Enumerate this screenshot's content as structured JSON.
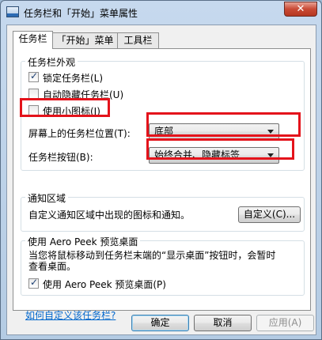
{
  "window": {
    "title": "任务栏和「开始」菜单属性",
    "close_glyph": "✕"
  },
  "tabs": [
    {
      "label": "任务栏",
      "active": true
    },
    {
      "label": "「开始」菜单",
      "active": false
    },
    {
      "label": "工具栏",
      "active": false
    }
  ],
  "appearance": {
    "title": "任务栏外观",
    "lock_taskbar": {
      "label": "锁定任务栏(L)",
      "checked": true
    },
    "auto_hide": {
      "label": "自动隐藏任务栏(U)",
      "checked": false
    },
    "small_icons": {
      "label": "使用小图标(I)",
      "checked": false
    },
    "location_label": "屏幕上的任务栏位置(T):",
    "location_value": "底部",
    "buttons_label": "任务栏按钮(B):",
    "buttons_value": "始终合并、隐藏标签"
  },
  "notification": {
    "title": "通知区域",
    "description": "自定义通知区域中出现的图标和通知。",
    "customize_button": "自定义(C)..."
  },
  "aero_peek": {
    "title": "使用 Aero Peek 预览桌面",
    "description_line1": "当您将鼠标移动到任务栏末端的“显示桌面”按钮时，会暂时",
    "description_line2": "查看桌面。",
    "checkbox": {
      "label": "使用 Aero Peek 预览桌面(P)",
      "checked": true
    }
  },
  "help_link": "如何自定义该任务栏?",
  "footer": {
    "ok": "确定",
    "cancel": "取消",
    "apply": "应用(A)"
  },
  "colors": {
    "annotation": "#e4131b",
    "link": "#0066cc"
  }
}
